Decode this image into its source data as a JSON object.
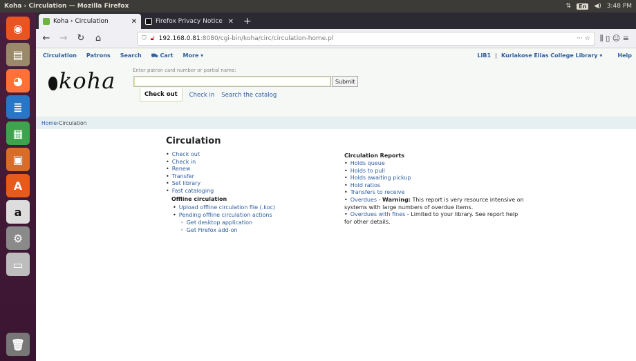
{
  "os": {
    "window_title": "Koha › Circulation — Mozilla Firefox",
    "tray": {
      "net": "⇅",
      "lang": "En",
      "volume": "◀)",
      "clock": "3:48 PM"
    }
  },
  "launcher": [
    {
      "name": "ubuntu-dash-icon",
      "glyph": "◉",
      "color": "#e95420"
    },
    {
      "name": "files-icon",
      "glyph": "▤",
      "color": "#9a8a6a"
    },
    {
      "name": "firefox-icon",
      "glyph": "◕",
      "color": "#ff7139"
    },
    {
      "name": "writer-icon",
      "glyph": "≣",
      "color": "#2a76c6"
    },
    {
      "name": "calc-icon",
      "glyph": "▦",
      "color": "#3fa34d"
    },
    {
      "name": "impress-icon",
      "glyph": "▣",
      "color": "#d86d2b"
    },
    {
      "name": "software-center-icon",
      "glyph": "A",
      "color": "#e65b1b"
    },
    {
      "name": "amazon-icon",
      "glyph": "a",
      "color": "#ddd"
    },
    {
      "name": "settings-icon",
      "glyph": "⚙",
      "color": "#8a8a8a"
    },
    {
      "name": "drive-icon",
      "glyph": "▭",
      "color": "#bdbdbd"
    },
    {
      "name": "trash-icon",
      "glyph": "🗑",
      "color": "#777"
    }
  ],
  "browser": {
    "tabs": [
      {
        "title": "Koha › Circulation",
        "favicon_color": "#6cb33f",
        "active": true
      },
      {
        "title": "Firefox Privacy Notice —",
        "favicon_color": "#111",
        "active": false
      }
    ],
    "new_tab": "+",
    "url_host": "192.168.0.81",
    "url_path": ":8080/cgi-bin/koha/circ/circulation-home.pl",
    "url_icons": "··· ☆",
    "right_icons": "⫼ ▯ ☺ ≡"
  },
  "koha": {
    "topnav": [
      "Circulation",
      "Patrons",
      "Search",
      "⛟ Cart",
      "More ▾"
    ],
    "branch": "LIB1",
    "library": "Kuriakose Elias College Library ▾",
    "help": "Help",
    "logo": "koha",
    "search_label": "Enter patron card number or partial name:",
    "search_value": "",
    "submit": "Submit",
    "subtabs": {
      "checkout": "Check out",
      "checkin": "Check in",
      "search": "Search the catalog"
    },
    "breadcrumb": {
      "home": "Home",
      "sep": " › ",
      "current": "Circulation"
    },
    "heading": "Circulation",
    "circ_links": [
      "Check out",
      "Check in",
      "Renew",
      "Transfer",
      "Set library",
      "Fast cataloging"
    ],
    "offline_heading": "Offline circulation",
    "offline_links": [
      "Upload offline circulation file (.koc)",
      "Pending offline circulation actions"
    ],
    "offline_sub": [
      "Get desktop application",
      "Get Firefox add-on"
    ],
    "reports_heading": "Circulation Reports",
    "reports": [
      {
        "link": "Holds queue"
      },
      {
        "link": "Holds to pull"
      },
      {
        "link": "Holds awaiting pickup"
      },
      {
        "link": "Hold ratios"
      },
      {
        "link": "Transfers to receive"
      },
      {
        "link": "Overdues",
        "dash": " - ",
        "bold": "Warning:",
        "rest": " This report is very resource intensive on systems with large numbers of overdue items."
      },
      {
        "link": "Overdues with fines",
        "dash": "",
        "bold": "",
        "rest": " - Limited to your library. See report help for other details."
      }
    ]
  }
}
